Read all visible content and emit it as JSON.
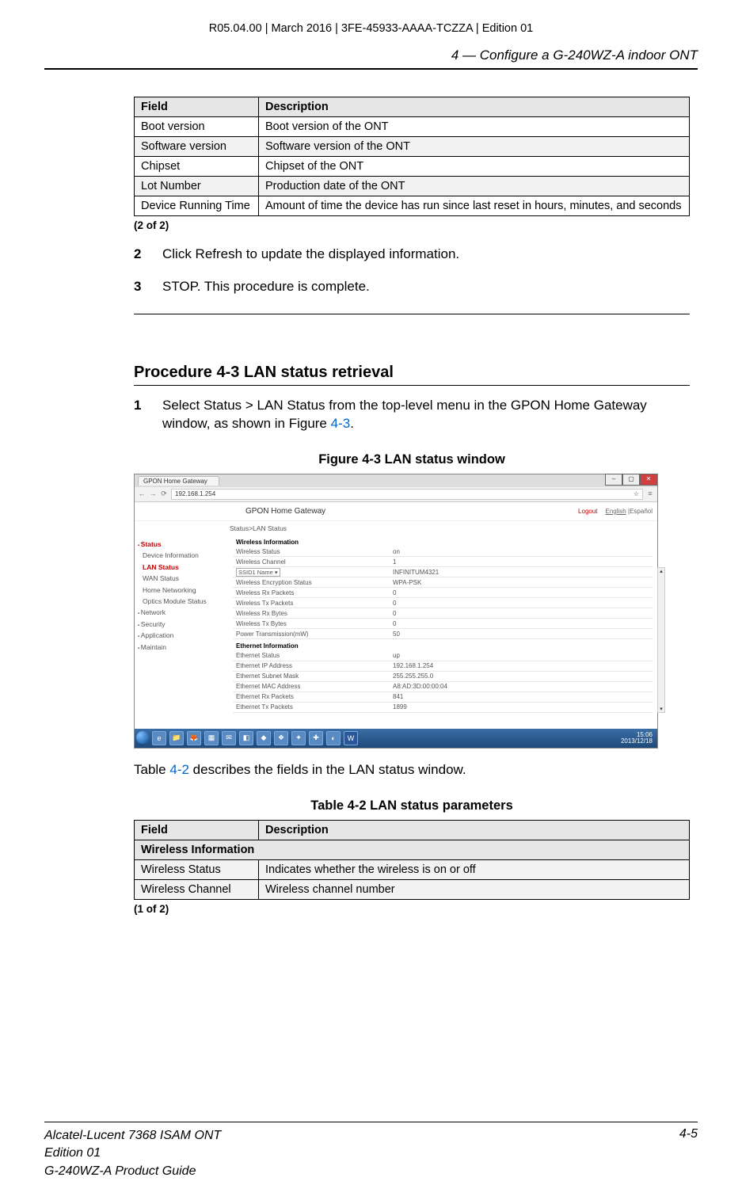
{
  "doc_meta": "R05.04.00 | March 2016 | 3FE-45933-AAAA-TCZZA | Edition 01",
  "section_header": "4 —  Configure a G-240WZ-A indoor ONT",
  "table1": {
    "header": {
      "field": "Field",
      "desc": "Description"
    },
    "rows": [
      {
        "field": "Boot version",
        "desc": "Boot version of the ONT"
      },
      {
        "field": "Software version",
        "desc": "Software version of the ONT"
      },
      {
        "field": "Chipset",
        "desc": "Chipset of the ONT"
      },
      {
        "field": "Lot Number",
        "desc": "Production date of the ONT"
      },
      {
        "field": "Device Running Time",
        "desc": "Amount of time the device has run since last reset in hours, minutes, and seconds"
      }
    ],
    "note": "(2 of 2)"
  },
  "steps_a": [
    {
      "n": "2",
      "t": "Click Refresh to update the displayed information."
    },
    {
      "n": "3",
      "t": "STOP. This procedure is complete."
    }
  ],
  "proc_title": "Procedure 4-3  LAN status retrieval",
  "step_b1": {
    "n": "1",
    "pre": "Select Status > LAN Status from the top-level menu in the GPON Home Gateway window, as shown in Figure ",
    "link": "4-3",
    "post": "."
  },
  "fig_caption": "Figure 4-3  LAN status window",
  "figure": {
    "tab_title": "GPON Home Gateway",
    "url": "192.168.1.254",
    "header_title": "GPON Home Gateway",
    "logout": "Logout",
    "lang1": "English",
    "lang2": "Español",
    "crumb": "Status>LAN Status",
    "nav": {
      "status": "Status",
      "dev_info": "Device Information",
      "lan_status": "LAN Status",
      "wan_status": "WAN Status",
      "home_net": "Home Networking",
      "optics": "Optics Module Status",
      "network": "Network",
      "security": "Security",
      "application": "Application",
      "maintain": "Maintain"
    },
    "wifi_head": "Wireless Information",
    "wifi": [
      {
        "k": "Wireless Status",
        "v": "on"
      },
      {
        "k": "Wireless Channel",
        "v": "1"
      },
      {
        "k": "ssid_sel",
        "v": "INFINITUM4321"
      },
      {
        "k": "Wireless Encryption Status",
        "v": "WPA-PSK"
      },
      {
        "k": "Wireless Rx Packets",
        "v": "0"
      },
      {
        "k": "Wireless Tx Packets",
        "v": "0"
      },
      {
        "k": "Wireless Rx Bytes",
        "v": "0"
      },
      {
        "k": "Wireless Tx Bytes",
        "v": "0"
      },
      {
        "k": "Power Transmission(mW)",
        "v": "50"
      }
    ],
    "ssid_label": "SSID1 Name",
    "eth_head": "Ethernet Information",
    "eth": [
      {
        "k": "Ethernet Status",
        "v": "up"
      },
      {
        "k": "Ethernet IP Address",
        "v": "192.168.1.254"
      },
      {
        "k": "Ethernet Subnet Mask",
        "v": "255.255.255.0"
      },
      {
        "k": "Ethernet MAC Address",
        "v": "A8:AD:3D:00:00:04"
      },
      {
        "k": "Ethernet Rx Packets",
        "v": "841"
      },
      {
        "k": "Ethernet Tx Packets",
        "v": "1899"
      }
    ],
    "clock": {
      "time": "15:06",
      "date": "2013/12/18"
    }
  },
  "after_fig": {
    "pre": "Table ",
    "link": "4-2",
    "post": " describes the fields in the LAN status window."
  },
  "tbl_caption": "Table 4-2 LAN status parameters",
  "table2": {
    "header": {
      "field": "Field",
      "desc": "Description"
    },
    "section": "Wireless Information",
    "rows": [
      {
        "field": "Wireless Status",
        "desc": "Indicates whether the wireless is on or off"
      },
      {
        "field": "Wireless Channel",
        "desc": "Wireless channel number"
      }
    ],
    "note": "(1 of 2)"
  },
  "footer": {
    "l1": "Alcatel-Lucent 7368 ISAM ONT",
    "l2": "Edition 01",
    "l3": "G-240WZ-A Product Guide",
    "pg": "4-5"
  }
}
